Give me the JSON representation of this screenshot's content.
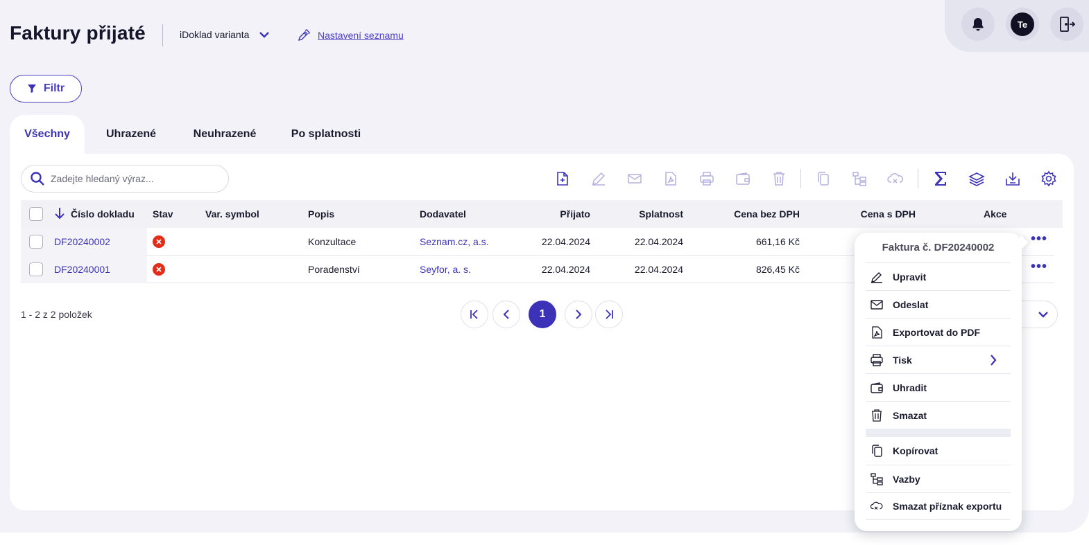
{
  "header": {
    "title": "Faktury přijaté",
    "variant": "iDoklad varianta",
    "settings_link": "Nastavení seznamu",
    "avatar_initials": "Te"
  },
  "filter": {
    "label": "Filtr"
  },
  "tabs": [
    {
      "label": "Všechny",
      "active": true
    },
    {
      "label": "Uhrazené",
      "active": false
    },
    {
      "label": "Neuhrazené",
      "active": false
    },
    {
      "label": "Po splatnosti",
      "active": false
    }
  ],
  "search": {
    "placeholder": "Zadejte hledaný výraz..."
  },
  "table": {
    "columns": [
      "Číslo dokladu",
      "Stav",
      "Var. symbol",
      "Popis",
      "Dodavatel",
      "Přijato",
      "Splatnost",
      "Cena bez DPH",
      "Cena s DPH",
      "Akce"
    ],
    "rows": [
      {
        "number": "DF20240002",
        "status": "unpaid",
        "var_symbol": "",
        "description": "Konzultace",
        "supplier": "Seznam.cz, a.s.",
        "received": "22.04.2024",
        "due": "22.04.2024",
        "price_net": "661,16 Kč",
        "price_gross": ""
      },
      {
        "number": "DF20240001",
        "status": "unpaid",
        "var_symbol": "",
        "description": "Poradenství",
        "supplier": "Seyfor, a. s.",
        "received": "22.04.2024",
        "due": "22.04.2024",
        "price_net": "826,45 Kč",
        "price_gross": ""
      }
    ]
  },
  "pagination": {
    "summary": "1 - 2 z 2 položek",
    "current_page": "1"
  },
  "context_menu": {
    "title": "Faktura č. DF20240002",
    "items": [
      {
        "label": "Upravit",
        "icon": "pencil-icon"
      },
      {
        "label": "Odeslat",
        "icon": "mail-icon"
      },
      {
        "label": "Exportovat do PDF",
        "icon": "pdf-icon"
      },
      {
        "label": "Tisk",
        "icon": "printer-icon"
      },
      {
        "label": "Uhradit",
        "icon": "wallet-icon"
      },
      {
        "label": "Smazat",
        "icon": "trash-icon"
      },
      {
        "label": "Kopírovat",
        "icon": "copy-icon"
      },
      {
        "label": "Vazby",
        "icon": "tree-icon"
      },
      {
        "label": "Smazat příznak exportu",
        "icon": "cloud-x-icon"
      }
    ]
  },
  "colors": {
    "accent": "#3b32b8",
    "background": "#f2f2f8",
    "status_error": "#e32d19"
  }
}
